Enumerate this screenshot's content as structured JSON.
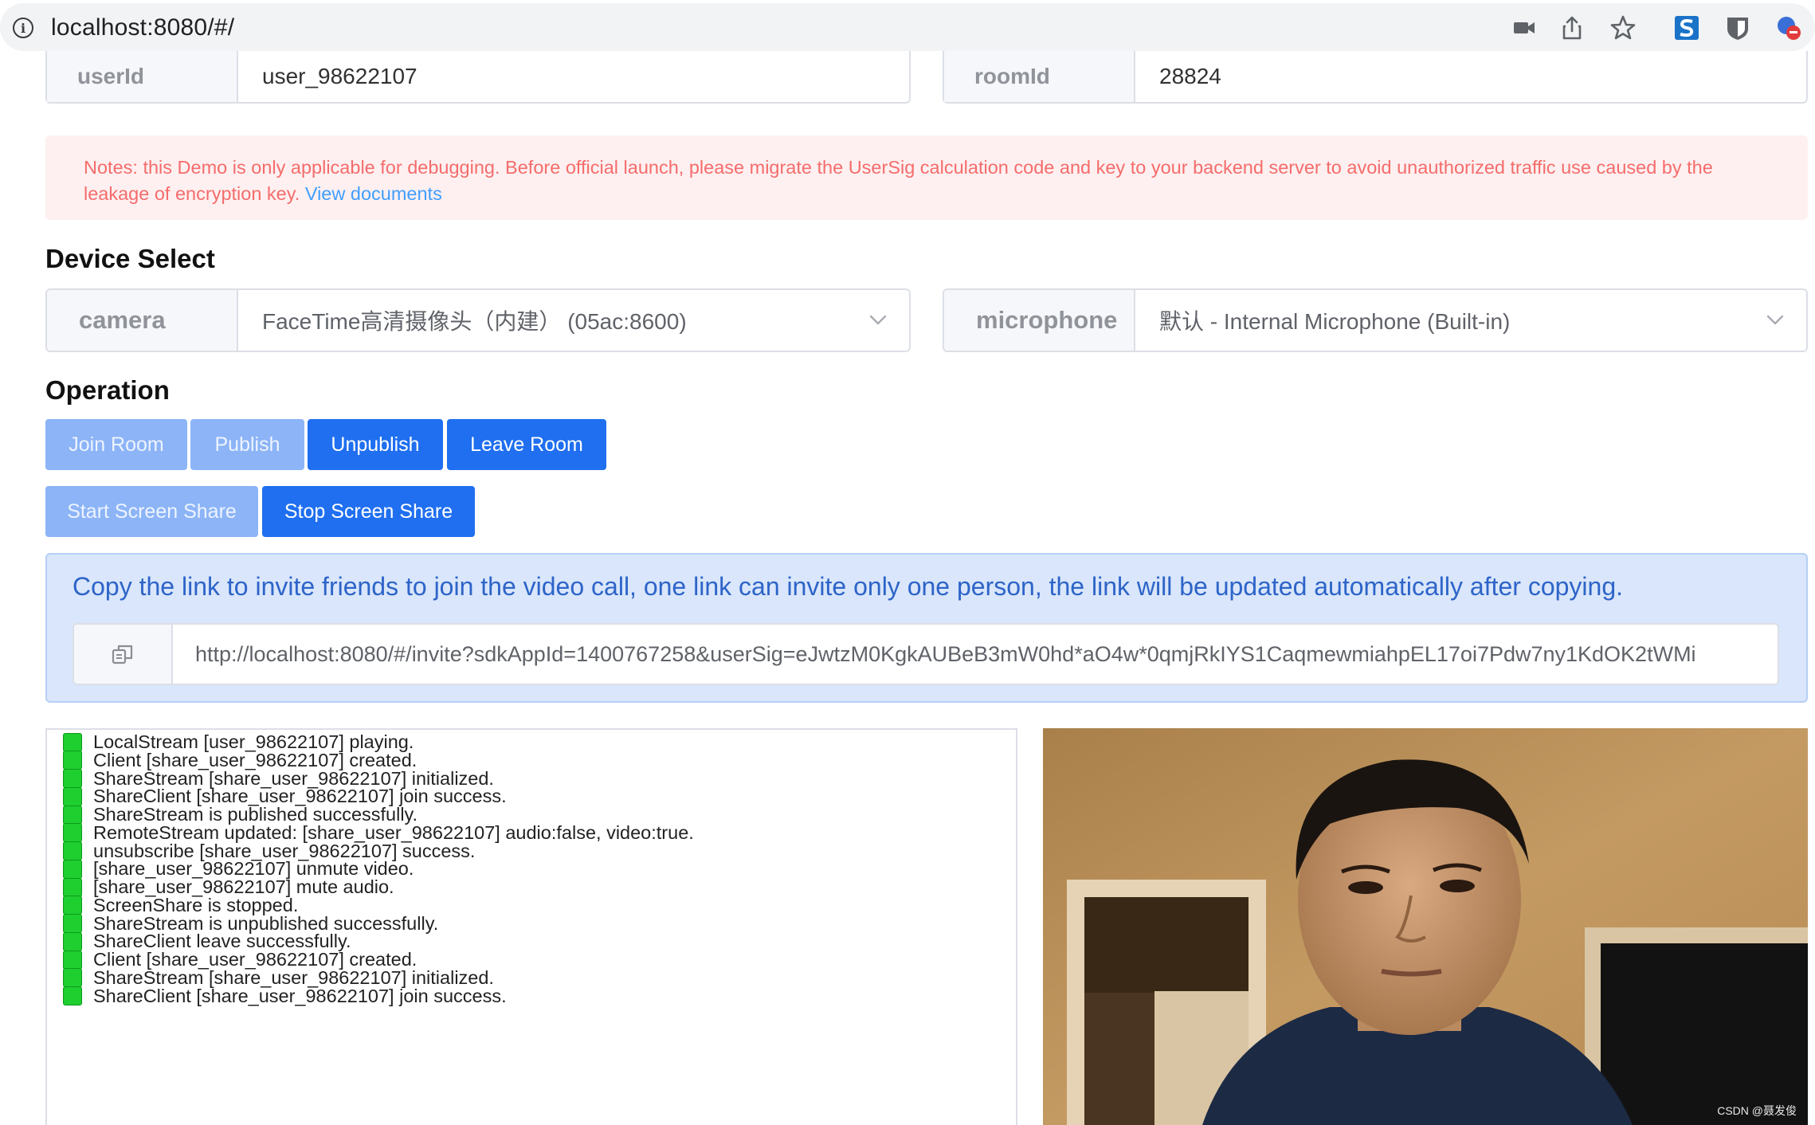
{
  "browser": {
    "url": "localhost:8080/#/"
  },
  "form": {
    "userId_label": "userId",
    "userId_value": "user_98622107",
    "roomId_label": "roomId",
    "roomId_value": "28824"
  },
  "notes": {
    "text": "Notes: this Demo is only applicable for debugging. Before official launch, please migrate the UserSig calculation code and key to your backend server to avoid unauthorized traffic use caused by the leakage of encryption key.",
    "link": "View documents"
  },
  "device_select": {
    "title": "Device Select",
    "camera_label": "camera",
    "camera_value": "FaceTime高清摄像头（内建） (05ac:8600)",
    "microphone_label": "microphone",
    "microphone_value": "默认 - Internal Microphone (Built-in)"
  },
  "operation": {
    "title": "Operation",
    "join_room": "Join Room",
    "publish": "Publish",
    "unpublish": "Unpublish",
    "leave_room": "Leave Room",
    "start_screen_share": "Start Screen Share",
    "stop_screen_share": "Stop Screen Share"
  },
  "invite": {
    "text": "Copy the link to invite friends to join the video call, one link can invite only one person, the link will be updated automatically after copying.",
    "link": "http://localhost:8080/#/invite?sdkAppId=1400767258&userSig=eJwtzM0KgkAUBeB3mW0hd*aO4w*0qmjRkIYS1CaqmewmiahpEL17oi7Pdw7ny1KdOK2tWMi"
  },
  "log": [
    "LocalStream [user_98622107] playing.",
    "Client [share_user_98622107] created.",
    "ShareStream [share_user_98622107] initialized.",
    "ShareClient [share_user_98622107] join success.",
    "ShareStream is published successfully.",
    "RemoteStream updated: [share_user_98622107] audio:false, video:true.",
    "unsubscribe [share_user_98622107] success.",
    "[share_user_98622107] unmute video.",
    "[share_user_98622107] mute audio.",
    "ScreenShare is stopped.",
    "ShareStream is unpublished successfully.",
    "ShareClient leave successfully.",
    "Client [share_user_98622107] created.",
    "ShareStream [share_user_98622107] initialized.",
    "ShareClient [share_user_98622107] join success."
  ],
  "video": {
    "watermark": "CSDN @聂发俊"
  },
  "colors": {
    "primary": "#1f6ff0",
    "primary_disabled": "#8cb4f7",
    "notes_bg": "#fef0f0",
    "notes_text": "#f56c6c",
    "invite_bg": "#d9e6fb",
    "log_square": "#1ecf2f"
  }
}
